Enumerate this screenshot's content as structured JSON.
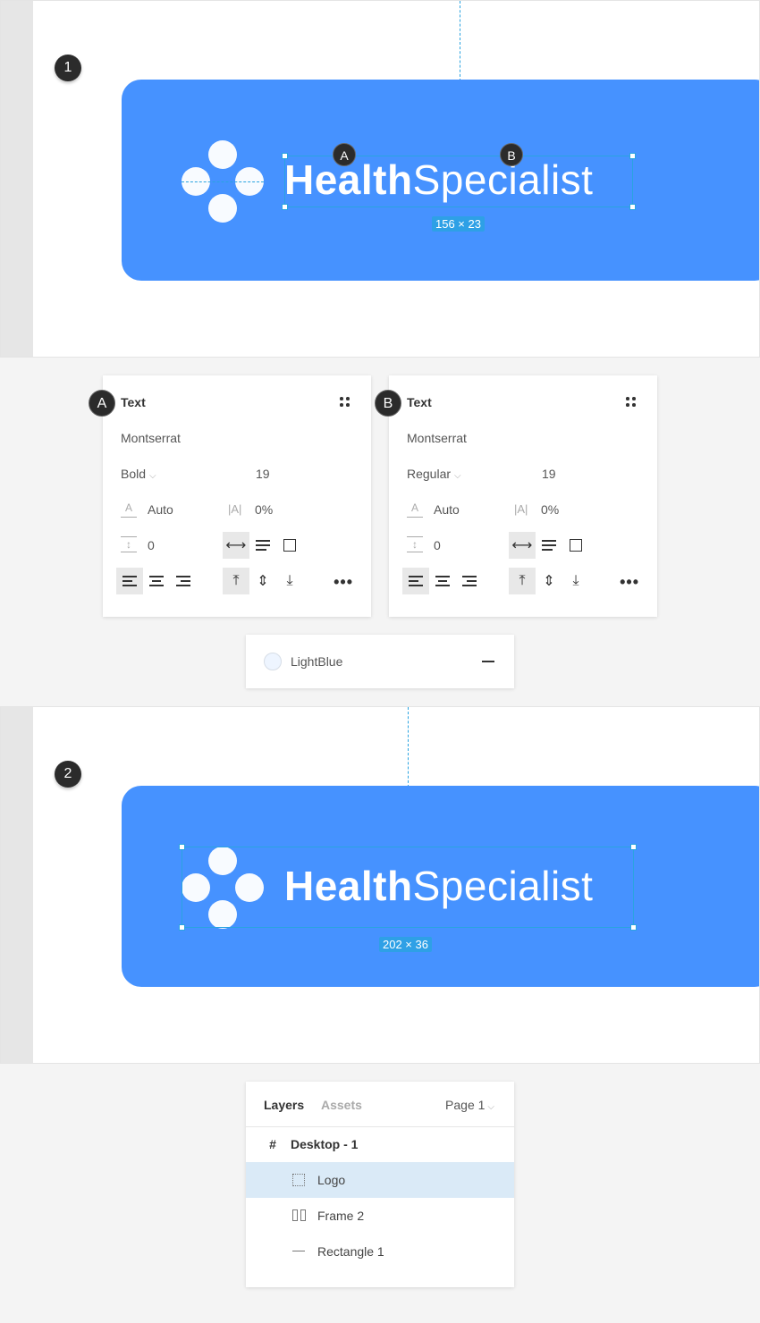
{
  "steps": {
    "one": {
      "number": "1",
      "dimensions": "156 × 23"
    },
    "two": {
      "number": "2",
      "dimensions": "202 × 36"
    }
  },
  "logo": {
    "word_bold": "Health",
    "word_regular": "Specialist",
    "banner_color": "#4692ff"
  },
  "markers": {
    "a": "A",
    "b": "B"
  },
  "text_panels": [
    {
      "marker": "A",
      "title": "Text",
      "font": "Montserrat",
      "weight": "Bold",
      "size": "19",
      "line_height": "Auto",
      "letter_spacing": "0%",
      "paragraph_spacing": "0"
    },
    {
      "marker": "B",
      "title": "Text",
      "font": "Montserrat",
      "weight": "Regular",
      "size": "19",
      "line_height": "Auto",
      "letter_spacing": "0%",
      "paragraph_spacing": "0"
    }
  ],
  "color_style": {
    "name": "LightBlue",
    "swatch": "#eef5ff"
  },
  "layers_panel": {
    "tab_layers": "Layers",
    "tab_assets": "Assets",
    "page": "Page 1",
    "items": [
      {
        "label": "Desktop - 1",
        "icon": "frame-hash-icon"
      },
      {
        "label": "Logo",
        "icon": "group-dashed-icon",
        "selected": true
      },
      {
        "label": "Frame 2",
        "icon": "frame-columns-icon"
      },
      {
        "label": "Rectangle 1",
        "icon": "line-icon"
      }
    ]
  }
}
